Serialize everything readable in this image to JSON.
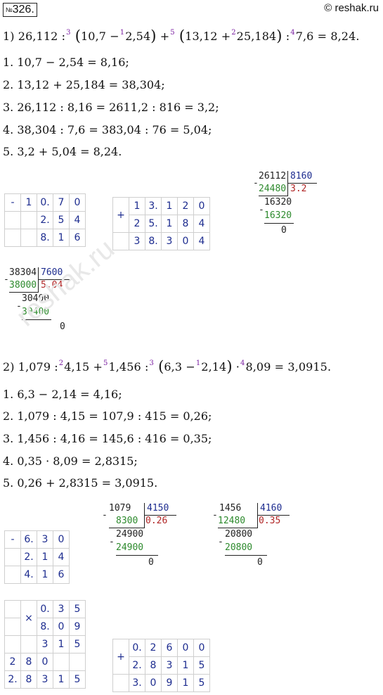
{
  "header": {
    "badge_prefix": "№",
    "badge_num": "326.",
    "site": "© reshak.ru"
  },
  "part1": {
    "eq": {
      "a": "1) 26,112 :",
      "s3": "3",
      "lp1": "(",
      "b": "10,7 −",
      "s1": "1",
      "c": "2,54",
      "rp1": ")",
      "d": " +",
      "s5": "5",
      "lp2": "(",
      "e": "13,12 +",
      "s2": "2",
      "f": "25,184",
      "rp2": ")",
      "g": " :",
      "s4": "4",
      "h": "7,6 = 8,24."
    },
    "steps": [
      "1.  10,7 − 2,54 = 8,16;",
      "2.  13,12 + 25,184 = 38,304;",
      "3.  26,112 : 8,16 = 2611,2 : 816 = 3,2;",
      "4.  38,304 : 7,6 = 383,04 : 76 = 5,04;",
      "5.  3,2 + 5,04 = 8,24."
    ],
    "grid_sub": {
      "op": "-",
      "r1": [
        "",
        "1",
        "0.",
        "7",
        "0"
      ],
      "r2": [
        "",
        "",
        "2.",
        "5",
        "4"
      ],
      "r3": [
        "",
        "",
        "8.",
        "1",
        "6"
      ]
    },
    "grid_add": {
      "op": "+",
      "r1": [
        "1",
        "3.",
        "1",
        "2",
        "0"
      ],
      "r2": [
        "2",
        "5.",
        "1",
        "8",
        "4"
      ],
      "r3": [
        "3",
        "8.",
        "3",
        "0",
        "4"
      ]
    },
    "div1": {
      "dividend": "26112",
      "divisor": "8160",
      "s1": "24480",
      "quot": "3.2",
      "r1": "16320",
      "s2": "16320",
      "r2": "0"
    },
    "div2": {
      "dividend": "38304",
      "divisor": "7600",
      "s1": "38000",
      "quot": "5.04",
      "r1": "30400",
      "s2": "30400",
      "r2": "0"
    }
  },
  "part2": {
    "eq": {
      "a": "2) 1,079 :",
      "s2": "2",
      "b": "4,15 +",
      "s5": "5",
      "c": "1,456 :",
      "s3": "3",
      "lp": "(",
      "d": "6,3 −",
      "s1": "1",
      "e": "2,14",
      "rp": ")",
      "f": " ·",
      "s4": "4",
      "g": "8,09 = 3,0915."
    },
    "steps": [
      "1.  6,3 − 2,14 = 4,16;",
      "2.  1,079 : 4,15 = 107,9 : 415 = 0,26;",
      "3.  1,456 : 4,16 = 145,6 : 416 = 0,35;",
      "4.  0,35 · 8,09 = 2,8315;",
      "5.  0,26 + 2,8315 = 3,0915."
    ],
    "grid_sub": {
      "op": "-",
      "r1": [
        "6.",
        "3",
        "0"
      ],
      "r2": [
        "2.",
        "1",
        "4"
      ],
      "r3": [
        "4.",
        "1",
        "6"
      ]
    },
    "div1": {
      "dividend": "1079",
      "divisor": "4150",
      "s1": "8300",
      "quot": "0.26",
      "r1": "24900",
      "s2": "24900",
      "r2": "0"
    },
    "div2": {
      "dividend": "1456",
      "divisor": "4160",
      "s1": "12480",
      "quot": "0.35",
      "r1": "20800",
      "s2": "20800",
      "r2": "0"
    },
    "grid_mul": {
      "op": "×",
      "r1": [
        "",
        "",
        "0.",
        "3",
        "5"
      ],
      "r2": [
        "",
        "",
        "8.",
        "0",
        "9"
      ],
      "r3": [
        "",
        "",
        "3",
        "1",
        "5"
      ],
      "r4": [
        "2",
        "8",
        "0",
        "",
        ""
      ],
      "r5": [
        "2.",
        "8",
        "3",
        "1",
        "5"
      ]
    },
    "grid_add": {
      "op": "+",
      "r1": [
        "0.",
        "2",
        "6",
        "0",
        "0"
      ],
      "r2": [
        "2.",
        "8",
        "3",
        "1",
        "5"
      ],
      "r3": [
        "3.",
        "0",
        "9",
        "1",
        "5"
      ]
    }
  },
  "watermark": "reshak.ru"
}
